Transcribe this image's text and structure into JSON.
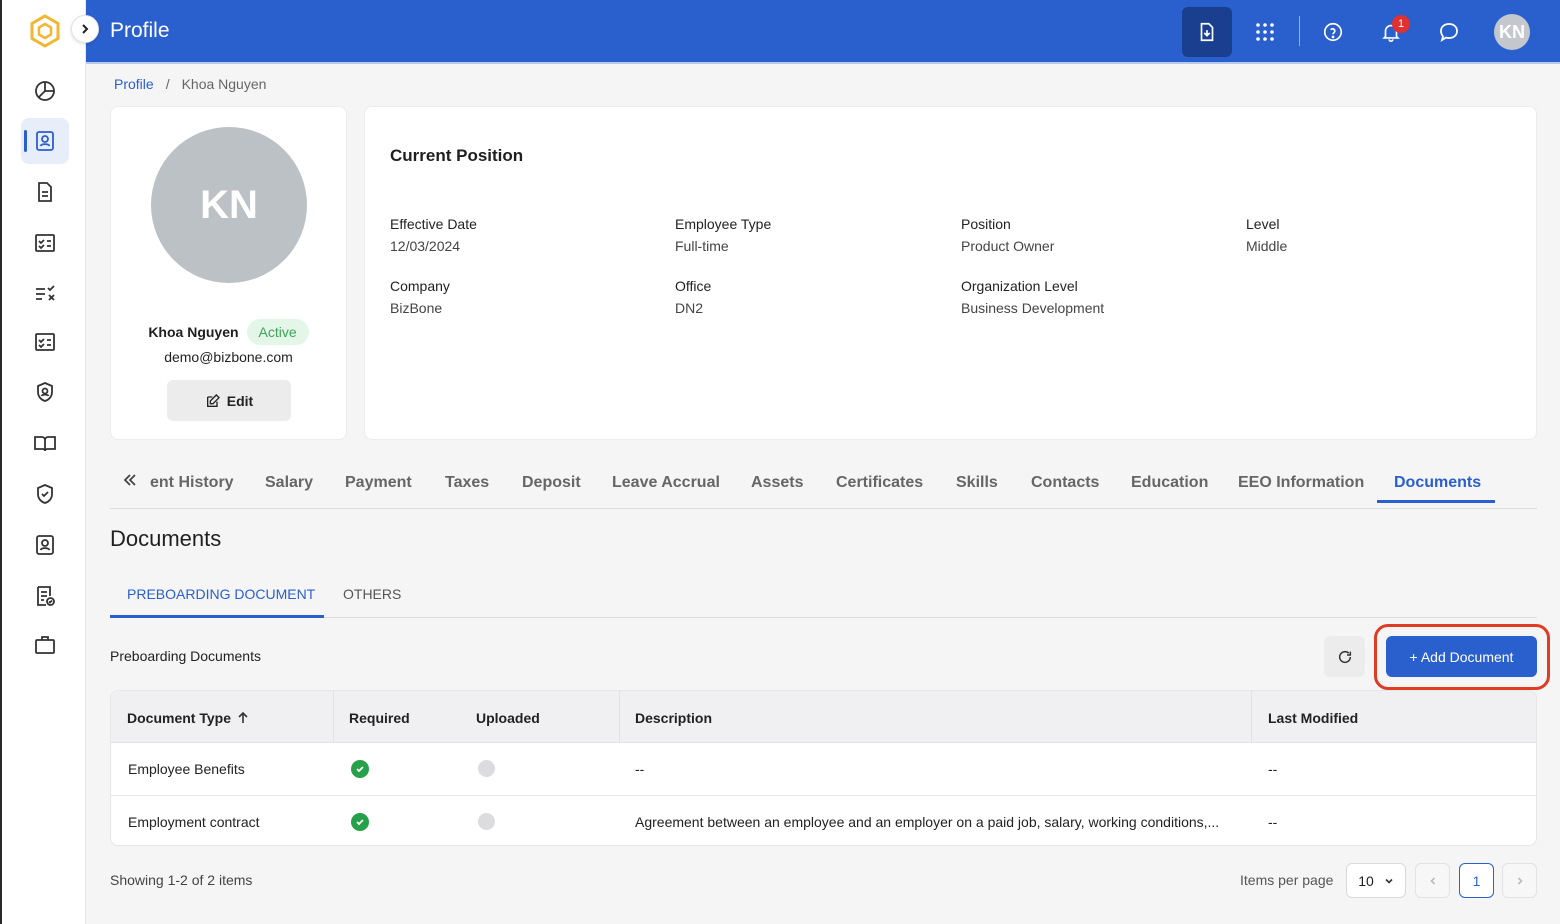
{
  "header": {
    "title": "Profile",
    "avatar_initials": "KN",
    "notification_count": "1"
  },
  "breadcrumb": {
    "root": "Profile",
    "separator": "/",
    "current": "Khoa Nguyen"
  },
  "profile": {
    "initials": "KN",
    "name": "Khoa Nguyen",
    "status": "Active",
    "email": "demo@bizbone.com",
    "edit_label": "Edit"
  },
  "position": {
    "title": "Current Position",
    "fields": [
      {
        "label": "Effective Date",
        "value": "12/03/2024"
      },
      {
        "label": "Employee Type",
        "value": "Full-time"
      },
      {
        "label": "Position",
        "value": "Product Owner"
      },
      {
        "label": "Level",
        "value": "Middle"
      },
      {
        "label": "Company",
        "value": "BizBone"
      },
      {
        "label": "Office",
        "value": "DN2"
      },
      {
        "label": "Organization Level",
        "value": "Business Development"
      }
    ]
  },
  "tabs": [
    "ent History",
    "Salary",
    "Payment",
    "Taxes",
    "Deposit",
    "Leave Accrual",
    "Assets",
    "Certificates",
    "Skills",
    "Contacts",
    "Education",
    "EEO Information",
    "Documents"
  ],
  "section_title": "Documents",
  "subtabs": [
    "PREBOARDING DOCUMENT",
    "OTHERS"
  ],
  "table_label": "Preboarding Documents",
  "add_button_label": "+ Add Document",
  "table": {
    "columns": [
      "Document Type",
      "Required",
      "Uploaded",
      "Description",
      "Last Modified"
    ],
    "rows": [
      {
        "type": "Employee Benefits",
        "description": "--",
        "last_modified": "--"
      },
      {
        "type": "Employment contract",
        "description": "Agreement between an employee and an employer on a paid job, salary, working conditions,...",
        "last_modified": "--"
      }
    ]
  },
  "pagination": {
    "showing": "Showing 1-2 of 2 items",
    "items_per_page_label": "Items per page",
    "items_per_page": "10",
    "current_page": "1"
  },
  "colors": {
    "primary": "#2a5fce",
    "success": "#27a04a",
    "highlight": "#e03b24"
  }
}
